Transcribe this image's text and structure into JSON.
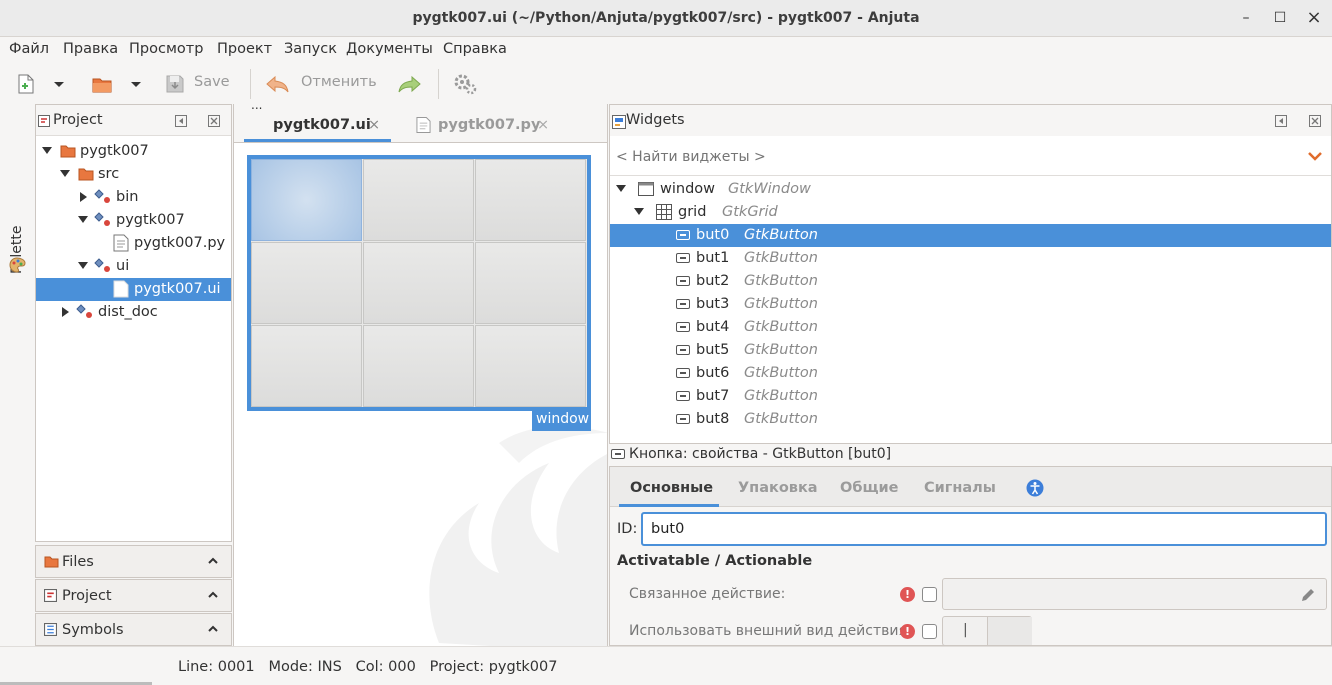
{
  "window": {
    "title": "pygtk007.ui (~/Python/Anjuta/pygtk007/src) - pygtk007 - Anjuta",
    "minimize": "–",
    "maximize": "☐",
    "close": "×"
  },
  "menu": [
    "Файл",
    "Правка",
    "Просмотр",
    "Проект",
    "Запуск",
    "Документы",
    "Справка"
  ],
  "toolbar": {
    "save_label": "Save",
    "undo_label": "Отменить"
  },
  "palette": {
    "label": "Palette"
  },
  "project_panel": {
    "title": "Project",
    "tree": [
      {
        "label": "pygtk007"
      },
      {
        "label": "src"
      },
      {
        "label": "bin"
      },
      {
        "label": "pygtk007"
      },
      {
        "label": "pygtk007.py"
      },
      {
        "label": "ui"
      },
      {
        "label": "pygtk007.ui"
      },
      {
        "label": "dist_doc"
      }
    ]
  },
  "side_sections": [
    {
      "label": "Files"
    },
    {
      "label": "Project"
    },
    {
      "label": "Symbols"
    }
  ],
  "editor": {
    "tabs": [
      {
        "label": "pygtk007.ui",
        "close": "×"
      },
      {
        "label": "pygtk007.py",
        "close": "×"
      }
    ],
    "window_tag": "window",
    "handle": "..."
  },
  "widgets_panel": {
    "title": "Widgets",
    "search_placeholder": "< Найти виджеты >",
    "rows": [
      {
        "name": "window",
        "type": "GtkWindow"
      },
      {
        "name": "grid",
        "type": "GtkGrid"
      },
      {
        "name": "but0",
        "type": "GtkButton"
      },
      {
        "name": "but1",
        "type": "GtkButton"
      },
      {
        "name": "but2",
        "type": "GtkButton"
      },
      {
        "name": "but3",
        "type": "GtkButton"
      },
      {
        "name": "but4",
        "type": "GtkButton"
      },
      {
        "name": "but5",
        "type": "GtkButton"
      },
      {
        "name": "but6",
        "type": "GtkButton"
      },
      {
        "name": "but7",
        "type": "GtkButton"
      },
      {
        "name": "but8",
        "type": "GtkButton"
      }
    ]
  },
  "properties": {
    "header": "Кнопка: свойства - GtkButton [but0]",
    "tabs": [
      "Основные",
      "Упаковка",
      "Общие",
      "Сигналы"
    ],
    "id_label": "ID:",
    "id_value": "but0",
    "section": "Activatable / Actionable",
    "related_action": "Связанное действие:",
    "use_action_appearance": "Использовать внешний вид действия:",
    "warn_symbol": "!",
    "toggle_label": "|"
  },
  "statusbar": {
    "text": "Line: 0001   Mode: INS   Col: 000   Project: pygtk007"
  },
  "colors": {
    "selection": "#4a90d9",
    "warning": "#e05555"
  }
}
